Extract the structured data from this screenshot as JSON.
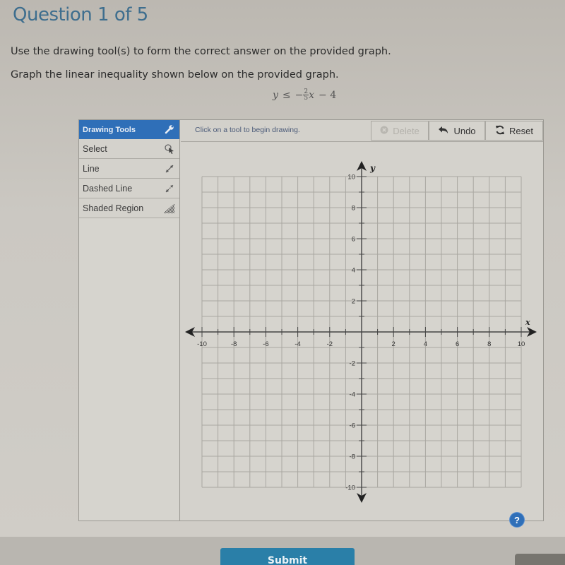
{
  "header": {
    "title": "Question 1 of 5"
  },
  "instructions": {
    "line1": "Use the drawing tool(s) to form the correct answer on the provided graph.",
    "line2": "Graph the linear inequality shown below on the provided graph."
  },
  "inequality": {
    "lhs": "y",
    "relation": "≤",
    "sign": "−",
    "numerator": "2",
    "denominator": "5",
    "variable": "x",
    "rest": "− 4"
  },
  "tools_panel": {
    "header": "Drawing Tools",
    "header_icon": "wrench-icon",
    "items": [
      {
        "label": "Select",
        "icon": "select-pointer-icon"
      },
      {
        "label": "Line",
        "icon": "line-arrows-icon"
      },
      {
        "label": "Dashed Line",
        "icon": "dashed-line-arrows-icon"
      },
      {
        "label": "Shaded Region",
        "icon": "shaded-region-icon"
      }
    ]
  },
  "toolbar": {
    "status": "Click on a tool to begin drawing.",
    "delete_label": "Delete",
    "undo_label": "Undo",
    "reset_label": "Reset"
  },
  "graph": {
    "x_min": -10,
    "x_max": 10,
    "y_min": -10,
    "y_max": 10,
    "grid_step": 1,
    "label_step": 2,
    "x_axis_label": "x",
    "y_axis_label": "y",
    "x_tick_labels": [
      "-10",
      "-8",
      "-6",
      "-4",
      "-2",
      "2",
      "4",
      "6",
      "8",
      "10"
    ],
    "y_tick_labels": [
      "10",
      "8",
      "6",
      "4",
      "2",
      "-2",
      "-4",
      "-6",
      "-8",
      "-10"
    ]
  },
  "colors": {
    "accent": "#2f6fb8",
    "submit": "#2a7fa8",
    "header_text": "#3e6e8e"
  },
  "help": {
    "label": "?"
  },
  "submit": {
    "label": "Submit"
  }
}
